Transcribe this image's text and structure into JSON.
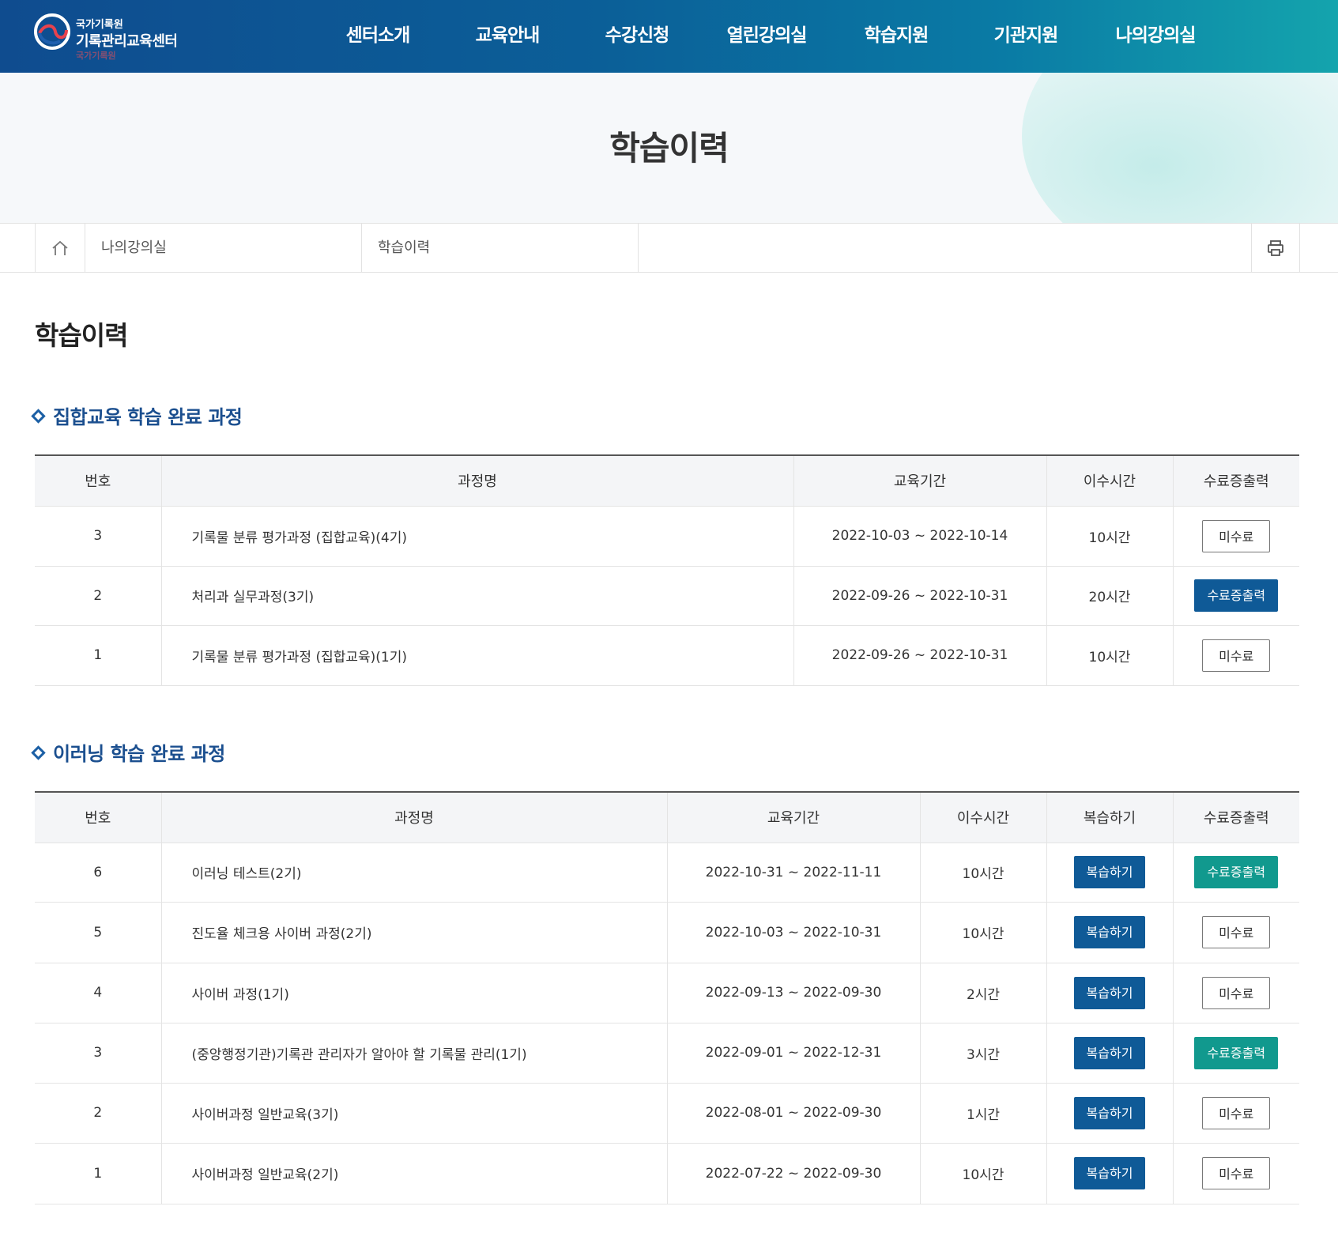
{
  "header": {
    "logo_small": "국가기록원",
    "logo_big": "기록관리교육센터",
    "logo_faint": "국가기록원",
    "nav": [
      "센터소개",
      "교육안내",
      "수강신청",
      "열린강의실",
      "학습지원",
      "기관지원",
      "나의강의실"
    ]
  },
  "visual": {
    "title": "학습이력"
  },
  "breadcrumb": {
    "level1": "나의강의실",
    "level2": "학습이력"
  },
  "page_title": "학습이력",
  "group": {
    "title": "집합교육 학습 완료 과정",
    "columns": [
      "번호",
      "과정명",
      "교육기간",
      "이수시간",
      "수료증출력"
    ],
    "rows": [
      {
        "no": "3",
        "name": "기록물 분류 평가과정 (집합교육)(4기)",
        "period": "2022-10-03 ~ 2022-10-14",
        "hours": "10시간",
        "cert": "미수료"
      },
      {
        "no": "2",
        "name": "처리과 실무과정(3기)",
        "period": "2022-09-26 ~ 2022-10-31",
        "hours": "20시간",
        "cert": "수료증출력"
      },
      {
        "no": "1",
        "name": "기록물 분류 평가과정 (집합교육)(1기)",
        "period": "2022-09-26 ~ 2022-10-31",
        "hours": "10시간",
        "cert": "미수료"
      }
    ]
  },
  "elearning": {
    "title": "이러닝 학습 완료 과정",
    "columns": [
      "번호",
      "과정명",
      "교육기간",
      "이수시간",
      "복습하기",
      "수료증출력"
    ],
    "rows": [
      {
        "no": "6",
        "name": "이러닝 테스트(2기)",
        "period": "2022-10-31 ~ 2022-11-11",
        "hours": "10시간",
        "review": "복습하기",
        "cert": "수료증출력"
      },
      {
        "no": "5",
        "name": "진도율 체크용 사이버 과정(2기)",
        "period": "2022-10-03 ~ 2022-10-31",
        "hours": "10시간",
        "review": "복습하기",
        "cert": "미수료"
      },
      {
        "no": "4",
        "name": "사이버 과정(1기)",
        "period": "2022-09-13 ~ 2022-09-30",
        "hours": "2시간",
        "review": "복습하기",
        "cert": "미수료"
      },
      {
        "no": "3",
        "name": "(중앙행정기관)기록관 관리자가 알아야 할 기록물 관리(1기)",
        "period": "2022-09-01 ~ 2022-12-31",
        "hours": "3시간",
        "review": "복습하기",
        "cert": "수료증출력"
      },
      {
        "no": "2",
        "name": "사이버과정 일반교육(3기)",
        "period": "2022-08-01 ~ 2022-09-30",
        "hours": "1시간",
        "review": "복습하기",
        "cert": "미수료"
      },
      {
        "no": "1",
        "name": "사이버과정 일반교육(2기)",
        "period": "2022-07-22 ~ 2022-09-30",
        "hours": "10시간",
        "review": "복습하기",
        "cert": "미수료"
      }
    ]
  },
  "icons": {
    "home": "home-icon",
    "print": "print-icon",
    "logo": "logo-emblem-icon"
  },
  "colors": {
    "header_start": "#0f4c8f",
    "header_end": "#14a4ad",
    "cert_button": "#0f5a97",
    "cert_button_teal": "#11998e",
    "review_button": "#0f5a97",
    "section_title": "#1b4f8f"
  }
}
